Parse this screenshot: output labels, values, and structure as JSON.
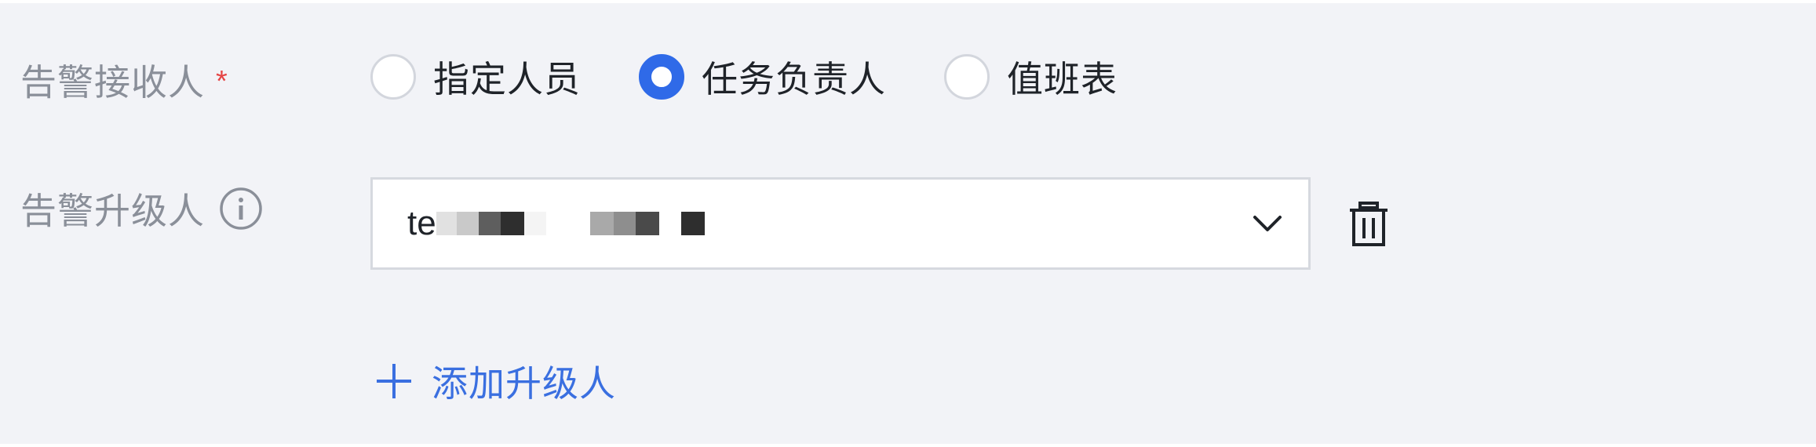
{
  "form": {
    "receiver": {
      "label": "告警接收人",
      "required_mark": "*",
      "options": [
        {
          "label": "指定人员",
          "checked": false
        },
        {
          "label": "任务负责人",
          "checked": true
        },
        {
          "label": "值班表",
          "checked": false
        }
      ]
    },
    "escalation": {
      "label": "告警升级人",
      "info_icon": "info-icon",
      "select_value_prefix": "te",
      "select_value_redacted": true,
      "dropdown_icon": "chevron-down-icon",
      "delete_icon": "trash-icon",
      "add_label": "添加升级人",
      "add_icon": "plus-icon"
    }
  },
  "colors": {
    "background": "#f2f3f7",
    "accent": "#2f6ae8",
    "link": "#3a6fe0",
    "required": "#e54545",
    "label": "#8a8f99",
    "text": "#1f2329"
  }
}
